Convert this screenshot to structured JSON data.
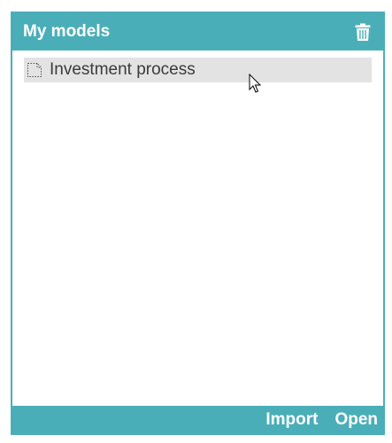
{
  "header": {
    "title": "My models",
    "delete_icon": "trash-icon"
  },
  "models": [
    {
      "label": "Investment process",
      "icon": "document-icon",
      "selected": true
    }
  ],
  "footer": {
    "import_label": "Import",
    "open_label": "Open"
  },
  "colors": {
    "accent": "#4aaeb9",
    "selected_row": "#e3e3e3",
    "text": "#3b3b3b"
  }
}
